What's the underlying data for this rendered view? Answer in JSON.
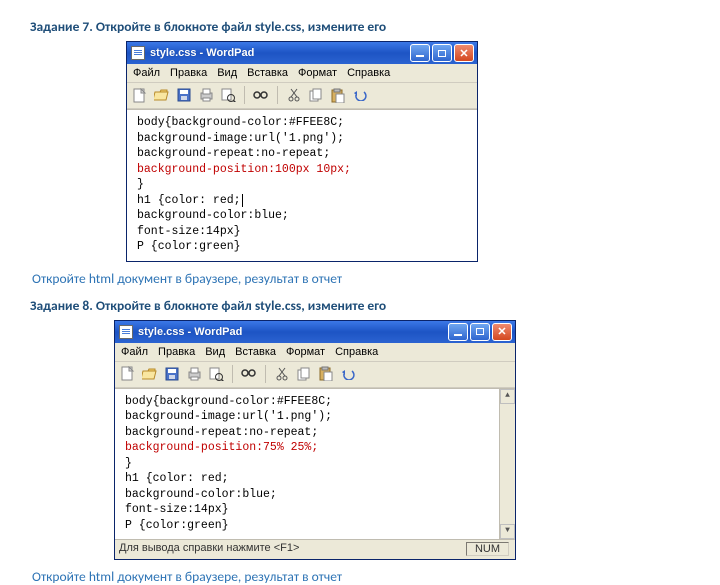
{
  "task7": {
    "heading": "Задание 7. Откройте в блокноте файл style.css, измените его",
    "instruction": "Откройте html документ в браузере, результат в отчет"
  },
  "task8": {
    "heading": "Задание 8. Откройте в блокноте файл style.css, измените его",
    "instruction": "Откройте html документ в браузере, результат в отчет"
  },
  "wordpad": {
    "title": "style.css - WordPad",
    "menu": {
      "file": "Файл",
      "edit": "Правка",
      "view": "Вид",
      "insert": "Вставка",
      "format": "Формат",
      "help": "Справка"
    },
    "btnMin": "–",
    "btnMax": "☐",
    "btnClose": "✕"
  },
  "code1": {
    "l1": "body{background-color:#FFEE8C;",
    "l2": "background-image:url('1.png');",
    "l3": "background-repeat:no-repeat;",
    "l4": "background-position:100px 10px;",
    "l5": "}",
    "l6": "h1 {color: red;",
    "l7": "background-color:blue;",
    "l8": "font-size:14px}",
    "l9": "P {color:green}"
  },
  "code2": {
    "l1": "body{background-color:#FFEE8C;",
    "l2": "background-image:url('1.png');",
    "l3": "background-repeat:no-repeat;",
    "l4": "background-position:75% 25%;",
    "l5": "}",
    "l6": "h1 {color: red;",
    "l7": "background-color:blue;",
    "l8": "font-size:14px}",
    "l9": "P {color:green}"
  },
  "status": {
    "hint": "Для вывода справки нажмите <F1>",
    "num": "NUM"
  }
}
